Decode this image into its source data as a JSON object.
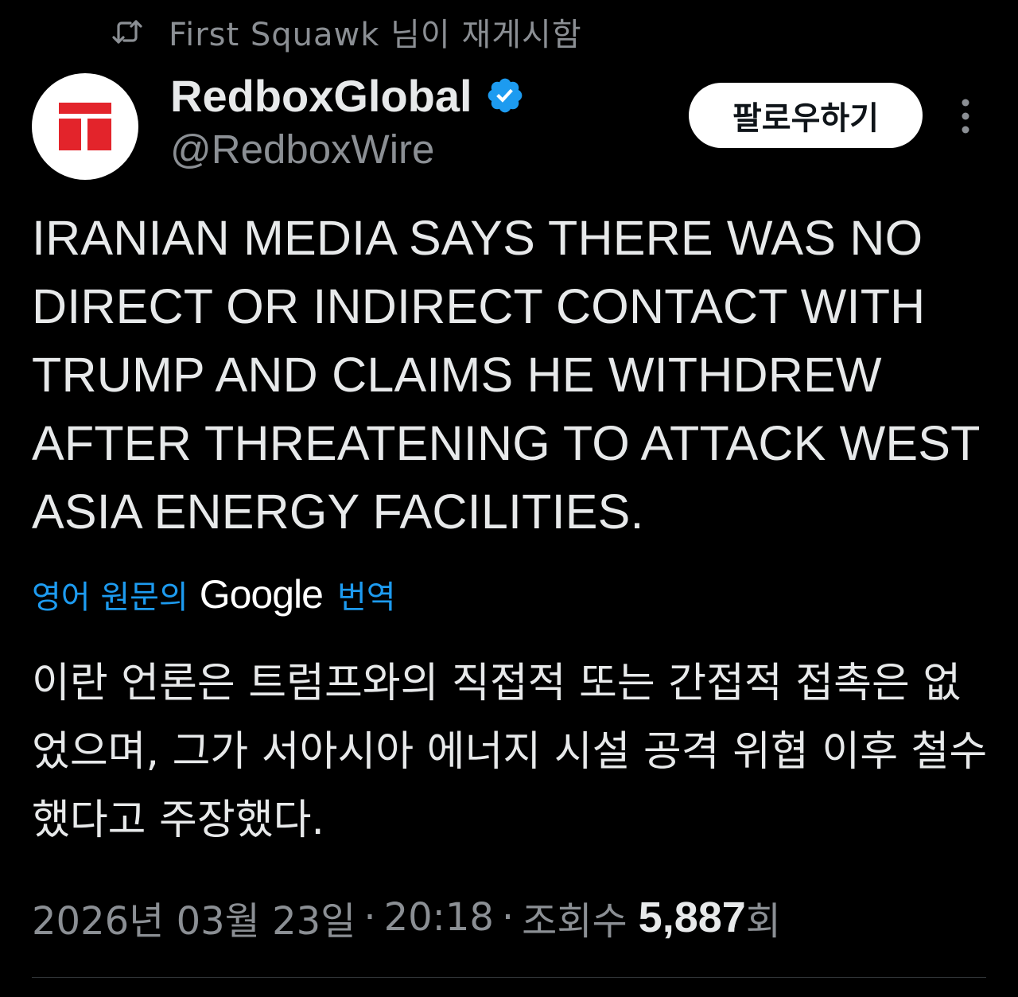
{
  "repost": {
    "icon": "repost-icon",
    "text": "First Squawk 님이 재게시함"
  },
  "author": {
    "avatar_icon": "redbox-logo",
    "display_name": "RedboxGlobal",
    "verified_icon": "verified-badge-icon",
    "handle": "@RedboxWire"
  },
  "actions": {
    "follow_label": "팔로우하기",
    "more_icon": "more-vertical-icon"
  },
  "tweet": {
    "text": "IRANIAN MEDIA SAYS THERE WAS NO DIRECT OR INDIRECT CONTACT WITH TRUMP AND CLAIMS HE WITHDREW AFTER THREATENING TO ATTACK WEST ASIA ENERGY FACILITIES."
  },
  "translation": {
    "label": "영어 원문의",
    "provider": "Google",
    "action": "번역",
    "text": "이란 언론은 트럼프와의 직접적 또는 간접적 접촉은 없었으며, 그가 서아시아 에너지 시설 공격 위협 이후 철수했다고 주장했다."
  },
  "meta": {
    "date": "2026년 03월 23일",
    "separator": "·",
    "time": "20:18",
    "views_label": "조회수",
    "views_count": "5,887",
    "views_unit": "회"
  },
  "colors": {
    "background": "#000000",
    "text_primary": "#e7e9ea",
    "text_secondary": "#8b8f94",
    "link": "#1d9bf0",
    "verified": "#1d9bf0",
    "brand_red": "#e3242b",
    "divider": "#2f3336"
  }
}
